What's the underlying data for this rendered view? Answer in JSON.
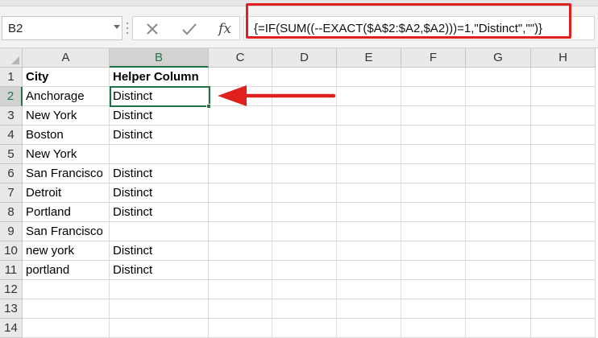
{
  "name_box": {
    "value": "B2"
  },
  "formula_bar": {
    "cancel_icon": "close-icon",
    "enter_icon": "check-icon",
    "function_label": "fx",
    "formula": "{=IF(SUM((--EXACT($A$2:$A2,$A2)))=1,\"Distinct\",\"\")}"
  },
  "columns": [
    "A",
    "B",
    "C",
    "D",
    "E",
    "F",
    "G",
    "H"
  ],
  "selected_column": "B",
  "rows": [
    {
      "n": "1",
      "a": "City",
      "b": "Helper Column"
    },
    {
      "n": "2",
      "a": "Anchorage",
      "b": "Distinct"
    },
    {
      "n": "3",
      "a": "New York",
      "b": "Distinct"
    },
    {
      "n": "4",
      "a": "Boston",
      "b": "Distinct"
    },
    {
      "n": "5",
      "a": "New York",
      "b": ""
    },
    {
      "n": "6",
      "a": "San Francisco",
      "b": "Distinct"
    },
    {
      "n": "7",
      "a": "Detroit",
      "b": "Distinct"
    },
    {
      "n": "8",
      "a": "Portland",
      "b": "Distinct"
    },
    {
      "n": "9",
      "a": "San Francisco",
      "b": ""
    },
    {
      "n": "10",
      "a": "new york",
      "b": "Distinct"
    },
    {
      "n": "11",
      "a": "portland",
      "b": "Distinct"
    },
    {
      "n": "12",
      "a": "",
      "b": ""
    },
    {
      "n": "13",
      "a": "",
      "b": ""
    },
    {
      "n": "14",
      "a": "",
      "b": ""
    }
  ],
  "selected_row": "2",
  "colors": {
    "accent": "#217346",
    "annotation": "#e0201f"
  },
  "annotation": {
    "arrow_icon": "left-arrow-icon",
    "highlight": "formula-highlight-box"
  }
}
